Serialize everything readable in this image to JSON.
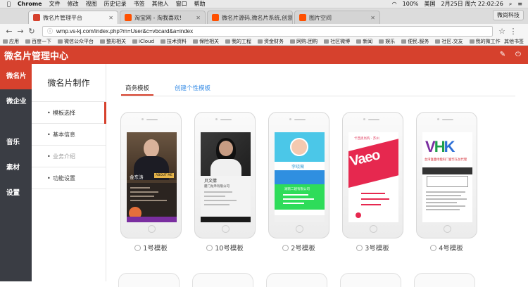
{
  "mac_menubar": {
    "items": [
      "Chrome",
      "文件",
      "修改",
      "视图",
      "历史记录",
      "书签",
      "其他人",
      "窗口",
      "帮助"
    ],
    "battery": "100%",
    "region": "美国",
    "datetime": "2月25日 周六 22:02:26"
  },
  "browser": {
    "tabs": [
      {
        "title": "微名片管理平台",
        "favicon_color": "#d6412d"
      },
      {
        "title": "淘宝网 - 淘我喜欢!",
        "favicon_color": "#ff5000"
      },
      {
        "title": "微名片源码,微名片系统,创意名片",
        "favicon_color": "#ff5000"
      },
      {
        "title": "图片空间",
        "favicon_color": "#ff5000"
      }
    ],
    "user_button": "微尚科技",
    "url": "wmp.vs-kj.com/index.php?m=User&c=vbcard&a=index",
    "bookmarks": [
      "应用",
      "百度一下",
      "微信公众平台",
      "整形相关",
      "iCloud",
      "技术资料",
      "保险相关",
      "我的工程",
      "资金财务",
      "网购.团购",
      "社区微博",
      "新闻",
      "娱乐",
      "便民.服务",
      "社区.交友",
      "我的微工作"
    ],
    "other_bookmarks": "其他书签"
  },
  "app": {
    "title": "微名片管理中心",
    "header_icons": [
      "edit-icon",
      "logout-icon"
    ],
    "brand_color": "#d6412d"
  },
  "sidebar": {
    "items": [
      "微名片",
      "微企业",
      "音乐",
      "素材",
      "设置"
    ]
  },
  "subnav": {
    "title": "微名片制作",
    "items": [
      "模板选择",
      "基本信息",
      "业务介绍",
      "功能设置"
    ]
  },
  "main": {
    "tabs": [
      "商务模板",
      "创建个性模板"
    ],
    "templates": [
      {
        "label": "1号模板",
        "name": "金东涛",
        "tag": "ABOUT ME"
      },
      {
        "label": "10号模板",
        "name": "贝文倩",
        "company": "厦门龙禾有限公司"
      },
      {
        "label": "2号模板",
        "name": "李晓薇",
        "company": "湖南二建有限公司"
      },
      {
        "label": "3号模板",
        "header": "卡西奥尚购 · 苏州"
      },
      {
        "label": "4号模板",
        "logo": "VHK",
        "subtitle": "台湾喜童绿能科门窗华东总代理"
      }
    ]
  }
}
